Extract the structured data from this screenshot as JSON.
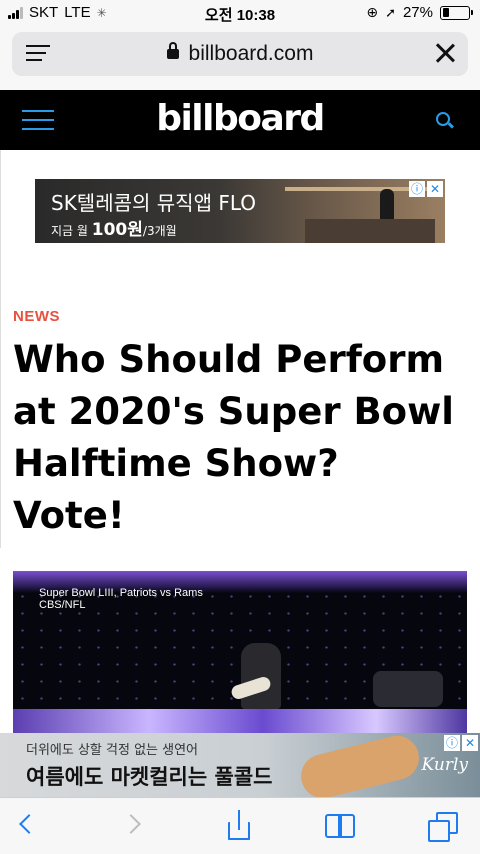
{
  "status_bar": {
    "carrier": "SKT",
    "network": "LTE",
    "loading_icon": "activity-spinner-icon",
    "time": "오전 10:38",
    "battery_percent": "27%",
    "battery_level": 0.27
  },
  "browser": {
    "url": "billboard.com",
    "menu_icon": "reader-menu-icon",
    "close_icon": "close-icon",
    "page_load_progress": 0.39
  },
  "site_header": {
    "logo": "billboard",
    "accent_color": "#2a9be6"
  },
  "ad_top": {
    "headline": "SK텔레콤의 뮤직앱 FLO",
    "price_prefix": "지금 월",
    "price": "100원",
    "price_suffix": "/3개월"
  },
  "article": {
    "kicker": "NEWS",
    "kicker_color": "#e8513d",
    "headline": "Who Should Perform at 2020's Super Bowl Halftime Show? Vote!",
    "image_caption_line1": "Super Bowl LIII, Patriots vs Rams",
    "image_caption_line2": "CBS/NFL"
  },
  "ad_bottom": {
    "subline": "더위에도 상할 걱정 없는 생연어",
    "headline": "여름에도 마켓컬리는 풀콜드",
    "brand": "Kurly"
  },
  "toolbar": {
    "back": "back-icon",
    "forward": "forward-icon",
    "share": "share-icon",
    "bookmarks": "bookmarks-icon",
    "tabs": "tabs-icon",
    "accent_color": "#1f7cf0"
  }
}
